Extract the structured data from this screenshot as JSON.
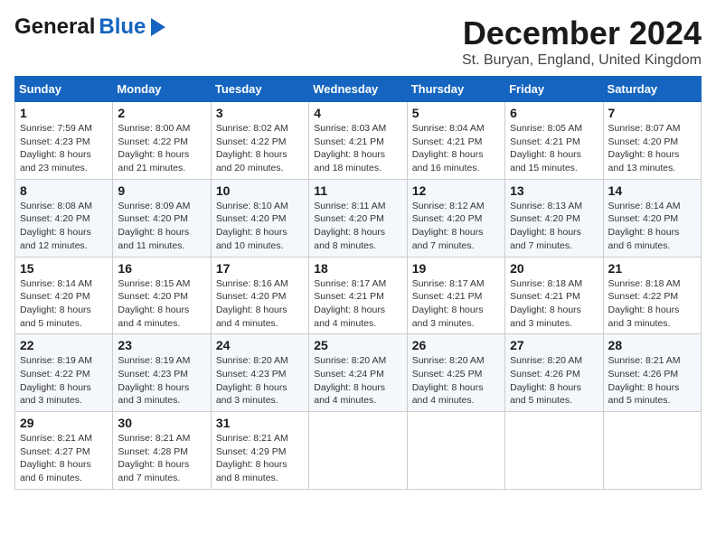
{
  "header": {
    "logo_general": "General",
    "logo_blue": "Blue",
    "month": "December 2024",
    "location": "St. Buryan, England, United Kingdom"
  },
  "weekdays": [
    "Sunday",
    "Monday",
    "Tuesday",
    "Wednesday",
    "Thursday",
    "Friday",
    "Saturday"
  ],
  "weeks": [
    [
      {
        "day": "1",
        "sunrise": "7:59 AM",
        "sunset": "4:23 PM",
        "daylight": "8 hours and 23 minutes."
      },
      {
        "day": "2",
        "sunrise": "8:00 AM",
        "sunset": "4:22 PM",
        "daylight": "8 hours and 21 minutes."
      },
      {
        "day": "3",
        "sunrise": "8:02 AM",
        "sunset": "4:22 PM",
        "daylight": "8 hours and 20 minutes."
      },
      {
        "day": "4",
        "sunrise": "8:03 AM",
        "sunset": "4:21 PM",
        "daylight": "8 hours and 18 minutes."
      },
      {
        "day": "5",
        "sunrise": "8:04 AM",
        "sunset": "4:21 PM",
        "daylight": "8 hours and 16 minutes."
      },
      {
        "day": "6",
        "sunrise": "8:05 AM",
        "sunset": "4:21 PM",
        "daylight": "8 hours and 15 minutes."
      },
      {
        "day": "7",
        "sunrise": "8:07 AM",
        "sunset": "4:20 PM",
        "daylight": "8 hours and 13 minutes."
      }
    ],
    [
      {
        "day": "8",
        "sunrise": "8:08 AM",
        "sunset": "4:20 PM",
        "daylight": "8 hours and 12 minutes."
      },
      {
        "day": "9",
        "sunrise": "8:09 AM",
        "sunset": "4:20 PM",
        "daylight": "8 hours and 11 minutes."
      },
      {
        "day": "10",
        "sunrise": "8:10 AM",
        "sunset": "4:20 PM",
        "daylight": "8 hours and 10 minutes."
      },
      {
        "day": "11",
        "sunrise": "8:11 AM",
        "sunset": "4:20 PM",
        "daylight": "8 hours and 8 minutes."
      },
      {
        "day": "12",
        "sunrise": "8:12 AM",
        "sunset": "4:20 PM",
        "daylight": "8 hours and 7 minutes."
      },
      {
        "day": "13",
        "sunrise": "8:13 AM",
        "sunset": "4:20 PM",
        "daylight": "8 hours and 7 minutes."
      },
      {
        "day": "14",
        "sunrise": "8:14 AM",
        "sunset": "4:20 PM",
        "daylight": "8 hours and 6 minutes."
      }
    ],
    [
      {
        "day": "15",
        "sunrise": "8:14 AM",
        "sunset": "4:20 PM",
        "daylight": "8 hours and 5 minutes."
      },
      {
        "day": "16",
        "sunrise": "8:15 AM",
        "sunset": "4:20 PM",
        "daylight": "8 hours and 4 minutes."
      },
      {
        "day": "17",
        "sunrise": "8:16 AM",
        "sunset": "4:20 PM",
        "daylight": "8 hours and 4 minutes."
      },
      {
        "day": "18",
        "sunrise": "8:17 AM",
        "sunset": "4:21 PM",
        "daylight": "8 hours and 4 minutes."
      },
      {
        "day": "19",
        "sunrise": "8:17 AM",
        "sunset": "4:21 PM",
        "daylight": "8 hours and 3 minutes."
      },
      {
        "day": "20",
        "sunrise": "8:18 AM",
        "sunset": "4:21 PM",
        "daylight": "8 hours and 3 minutes."
      },
      {
        "day": "21",
        "sunrise": "8:18 AM",
        "sunset": "4:22 PM",
        "daylight": "8 hours and 3 minutes."
      }
    ],
    [
      {
        "day": "22",
        "sunrise": "8:19 AM",
        "sunset": "4:22 PM",
        "daylight": "8 hours and 3 minutes."
      },
      {
        "day": "23",
        "sunrise": "8:19 AM",
        "sunset": "4:23 PM",
        "daylight": "8 hours and 3 minutes."
      },
      {
        "day": "24",
        "sunrise": "8:20 AM",
        "sunset": "4:23 PM",
        "daylight": "8 hours and 3 minutes."
      },
      {
        "day": "25",
        "sunrise": "8:20 AM",
        "sunset": "4:24 PM",
        "daylight": "8 hours and 4 minutes."
      },
      {
        "day": "26",
        "sunrise": "8:20 AM",
        "sunset": "4:25 PM",
        "daylight": "8 hours and 4 minutes."
      },
      {
        "day": "27",
        "sunrise": "8:20 AM",
        "sunset": "4:26 PM",
        "daylight": "8 hours and 5 minutes."
      },
      {
        "day": "28",
        "sunrise": "8:21 AM",
        "sunset": "4:26 PM",
        "daylight": "8 hours and 5 minutes."
      }
    ],
    [
      {
        "day": "29",
        "sunrise": "8:21 AM",
        "sunset": "4:27 PM",
        "daylight": "8 hours and 6 minutes."
      },
      {
        "day": "30",
        "sunrise": "8:21 AM",
        "sunset": "4:28 PM",
        "daylight": "8 hours and 7 minutes."
      },
      {
        "day": "31",
        "sunrise": "8:21 AM",
        "sunset": "4:29 PM",
        "daylight": "8 hours and 8 minutes."
      },
      null,
      null,
      null,
      null
    ]
  ]
}
